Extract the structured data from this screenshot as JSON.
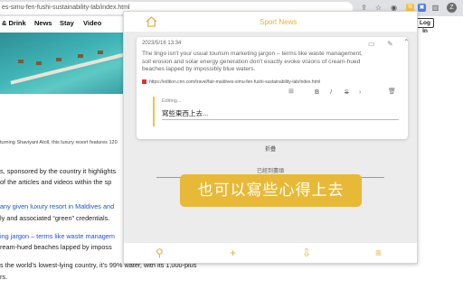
{
  "browser": {
    "url": "es-simu-fen-fushi-sustainability-lab/index.html",
    "profile_initial": "Z"
  },
  "page": {
    "nav": [
      "& Drink",
      "News",
      "Stay",
      "Video"
    ],
    "login": "Log In",
    "caption_line": "turning Shaviyani Atoll, this luxury resort features 120",
    "lines": [
      "s, sponsored by the country it highlights",
      "of the articles and videos within the sp",
      "any given luxury resort in Maldives and",
      "ly and associated “green” credentials.",
      "ing jargon – terms like waste managem",
      "ream-hued beaches lapped by imposs",
      "s the world’s lowest-lying country, it’s 99% water, with its 1,000-plus",
      "rs."
    ]
  },
  "popup": {
    "title": "Sport News",
    "card": {
      "date": "2023/5/16 13:34",
      "text": "The lingo isn't your usual tourism marketing jargon – terms like waste management, soil erosion and solar energy generation don't exactly evoke visions of cream-hued beaches lapped by impossibly blue waters.",
      "source": "https://edition.cnn.com/travel/fair-maldives-simu-fen-fushi-sustainability-lab/index.html",
      "editor_status": "Editing...",
      "editor_text": "寫些東西上去...",
      "fold_label": "折疊"
    },
    "read_label": "已經到盡頭",
    "cta_text": "也可以寫些心得上去"
  },
  "colors": {
    "accent": "#e8b937",
    "panel_bg": "#ececec"
  }
}
